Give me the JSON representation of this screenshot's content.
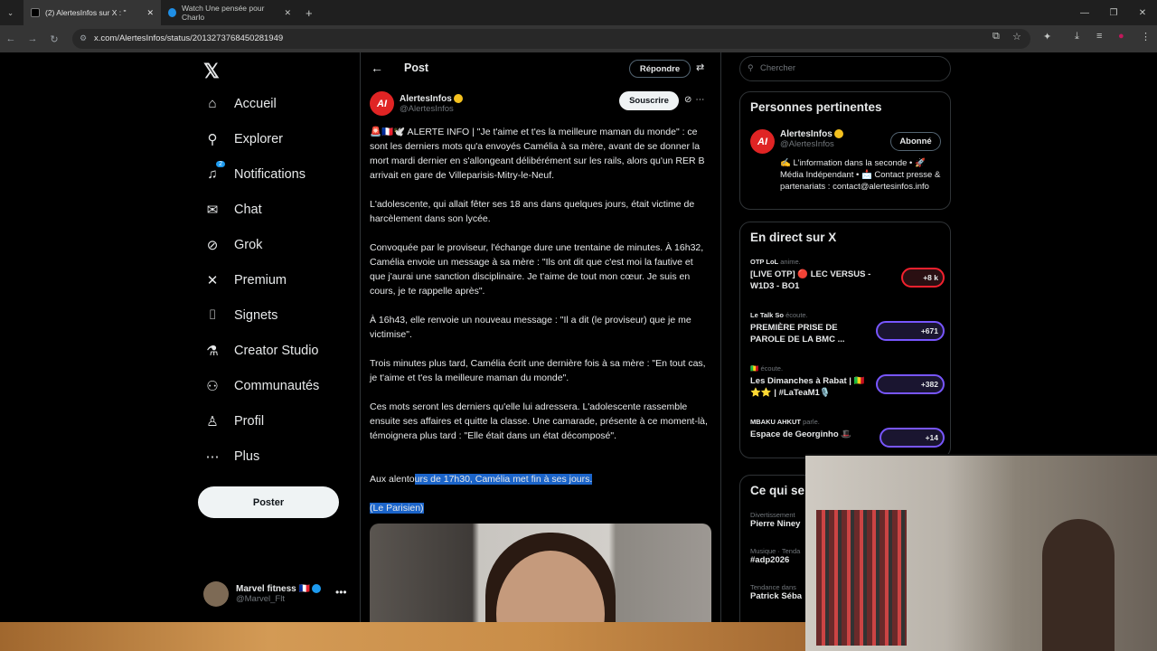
{
  "browser": {
    "tabs": [
      {
        "label": "(2) AlertesInfos sur X : \"",
        "active": true
      },
      {
        "label": "Watch Une pensée pour Charlo",
        "active": false
      }
    ],
    "url": "x.com/AlertesInfos/status/2013273768450281949"
  },
  "nav": {
    "items": [
      {
        "label": "Accueil",
        "icon": "home-icon"
      },
      {
        "label": "Explorer",
        "icon": "search-icon"
      },
      {
        "label": "Notifications",
        "icon": "bell-icon",
        "badge": "2"
      },
      {
        "label": "Chat",
        "icon": "mail-icon"
      },
      {
        "label": "Grok",
        "icon": "grok-icon"
      },
      {
        "label": "Premium",
        "icon": "x-icon"
      },
      {
        "label": "Signets",
        "icon": "bookmark-icon"
      },
      {
        "label": "Creator Studio",
        "icon": "flask-icon"
      },
      {
        "label": "Communautés",
        "icon": "people-icon"
      },
      {
        "label": "Profil",
        "icon": "person-icon"
      },
      {
        "label": "Plus",
        "icon": "more-circle-icon"
      }
    ],
    "post_button": "Poster",
    "account": {
      "name": "Marvel fitness 🇫🇷",
      "handle": "@Marvel_Flt"
    }
  },
  "post": {
    "header_title": "Post",
    "reply_label": "Répondre",
    "author_name": "AlertesInfos",
    "author_handle": "@AlertesInfos",
    "subscribe_label": "Souscrire",
    "paragraphs": [
      "🚨🇫🇷🕊️ ALERTE INFO | \"Je t'aime et t'es la meilleure maman du monde\" : ce sont les derniers mots qu'a envoyés Camélia à sa mère, avant de se donner la mort mardi dernier en s'allongeant délibérément sur les rails, alors qu'un RER B arrivait en gare de Villeparisis-Mitry-le-Neuf.",
      "L'adolescente, qui allait fêter ses 18 ans dans quelques jours, était victime de harcèlement dans son lycée.",
      "Convoquée par le proviseur, l'échange dure une trentaine de minutes. À 16h32, Camélia envoie un message à sa mère : \"Ils ont dit que c'est moi la fautive et que j'aurai une sanction disciplinaire. Je t'aime de tout mon cœur. Je suis en cours, je te rappelle après\".",
      "À 16h43, elle renvoie un nouveau message : \"Il a dit (le proviseur) que je me victimise\".",
      "Trois minutes plus tard, Camélia écrit une dernière fois à sa mère : \"En tout cas, je t'aime et t'es la meilleure maman du monde\".",
      "Ces mots seront les derniers qu'elle lui adressera. L'adolescente rassemble ensuite ses affaires et quitte la classe. Une camarade, présente à ce moment-là, témoignera plus tard : \"Elle était dans un état décomposé\"."
    ],
    "last_para_plain": "Aux alento",
    "last_para_highlight": "urs de 17h30, Camélia met fin à ses jours.",
    "source": "(Le Parisien)"
  },
  "sidebar": {
    "search_placeholder": "Chercher",
    "relevant": {
      "title": "Personnes pertinentes",
      "name": "AlertesInfos",
      "handle": "@AlertesInfos",
      "follow_label": "Abonné",
      "bio": "✍️ L'information dans la seconde • 🚀 Média Indépendant • 📩 Contact presse & partenariats : contact@alertesinfos.info"
    },
    "live": {
      "title": "En direct sur X",
      "items": [
        {
          "who": "OTP LoL",
          "verb": "anime.",
          "title": "[LIVE OTP] 🔴 LEC VERSUS - W1D3 - BO1",
          "count": "+8 k"
        },
        {
          "who": "Le Talk So",
          "verb": "écoute.",
          "title": "PREMIÈRE PRISE DE PAROLE DE LA BMC ...",
          "count": "+671"
        },
        {
          "who": "🇲🇱",
          "verb": "écoute.",
          "title": "Les Dimanches à Rabat | 🇲🇱⭐⭐ | #LaTeaM1🎙️",
          "count": "+382"
        },
        {
          "who": "MBAKU AHKUT",
          "verb": "parle.",
          "title": "Espace de Georginho 🎩",
          "count": "+14"
        }
      ]
    },
    "trends": {
      "title": "Ce qui se",
      "items": [
        {
          "category": "Divertissement",
          "name": "Pierre Niney"
        },
        {
          "category": "Musique · Tenda",
          "name": "#adp2026"
        },
        {
          "category": "Tendance dans",
          "name": "Patrick Séba"
        }
      ]
    }
  }
}
